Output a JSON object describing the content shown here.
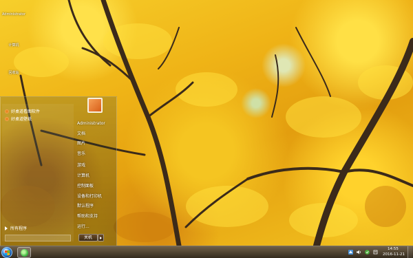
{
  "desktop": {
    "icons": [
      {
        "label": "Administrator",
        "icon": "user-folder-icon"
      },
      {
        "label": "计算机",
        "icon": "computer-icon"
      },
      {
        "label": "回收站",
        "icon": "recycle-bin-icon"
      }
    ]
  },
  "start_menu": {
    "pinned": [
      {
        "label": "好桌道看图软件",
        "icon": "image-viewer-icon"
      },
      {
        "label": "好桌道壁纸",
        "icon": "wallpaper-app-icon"
      }
    ],
    "all_programs": "所有程序",
    "right_items": [
      "Administrator",
      "文档",
      "图片",
      "音乐",
      "游戏",
      "计算机",
      "控制面板",
      "设备和打印机",
      "默认程序",
      "帮助和支持",
      "运行..."
    ],
    "shutdown_label": "关机"
  },
  "taskbar": {
    "time": "14:55",
    "date": "2016-11-21",
    "tray_icons": [
      "network-icon",
      "volume-icon",
      "security-icon",
      "action-center-icon"
    ]
  },
  "colors": {
    "foliage": "#f2c11f",
    "trunk": "#3b2a1a",
    "taskbar": "#3a2a10"
  }
}
